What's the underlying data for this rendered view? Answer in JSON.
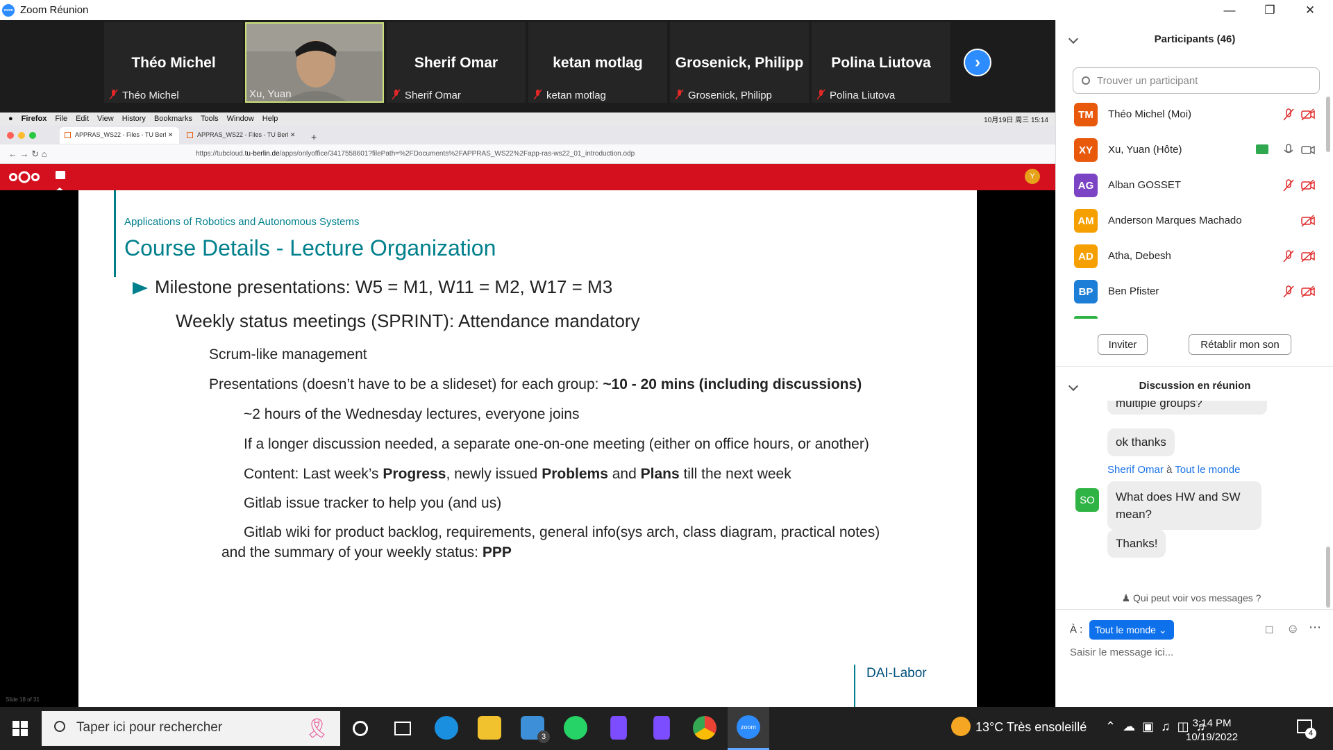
{
  "window": {
    "title": "Zoom Réunion",
    "controls": [
      "minimize-icon",
      "restore-icon",
      "close-icon"
    ]
  },
  "strip": {
    "tiles": [
      {
        "big": "Théo Michel",
        "small": "Théo Michel",
        "muted": true
      },
      {
        "big": "",
        "small": "Xu, Yuan",
        "muted": false,
        "video": true
      },
      {
        "big": "Sherif Omar",
        "small": "Sherif Omar",
        "muted": true
      },
      {
        "big": "ketan motlag",
        "small": "ketan motlag",
        "muted": true
      },
      {
        "big": "Grosenick, Philipp",
        "small": "Grosenick, Philipp",
        "muted": true
      },
      {
        "big": "Polina Liutova",
        "small": "Polina Liutova",
        "muted": true
      }
    ]
  },
  "share": {
    "mac_menu": [
      "Firefox",
      "File",
      "Edit",
      "View",
      "History",
      "Bookmarks",
      "Tools",
      "Window",
      "Help"
    ],
    "mac_clock": "10月19日 周三 15:14",
    "tabs": [
      "APPRAS_WS22 - Files - TU Berl",
      "APPRAS_WS22 - Files - TU Berl"
    ],
    "url_prefix": "https://tubcloud.",
    "url_domain": "tu-berlin.de",
    "url_rest": "/apps/onlyoffice/3417558601?filePath=%2FDocuments%2FAPPRAS_WS22%2Fapp-ras-ws22_01_introduction.odp",
    "slide": {
      "subtitle": "Applications of Robotics and Autonomous Systems",
      "title": "Course Details - Lecture Organization",
      "bullet1": "Milestone presentations: W5 = M1, W11 = M2, W17 = M3",
      "bullet2": "Weekly status meetings (SPRINT): Attendance mandatory",
      "bullet3": "Scrum-like management",
      "bullet4_pre": "Presentations (doesn’t have to be a slideset) for each group: ",
      "bullet4_bold": "~10 - 20 mins (including discussions)",
      "bullet5": "~2 hours of the Wednesday lectures, everyone joins",
      "bullet6": "If a longer discussion needed, a separate one-on-one meeting (either on office hours, or another)",
      "bullet7_a": "Content: Last week’s ",
      "bullet7_b": "Progress",
      "bullet7_c": ", newly issued ",
      "bullet7_d": "Problems",
      "bullet7_e": " and ",
      "bullet7_f": "Plans",
      "bullet7_g": " till the next week",
      "bullet8": "Gitlab issue tracker to help you (and us)",
      "bullet9_line1": "Gitlab wiki for product backlog, requirements, general info(sys arch, class diagram, practical notes)",
      "bullet9_line2": "and the summary of your weekly status: ",
      "bullet9_bold": "PPP",
      "logo": "DAI-Labor",
      "slide_counter": "Slide 18 of 31"
    }
  },
  "participants": {
    "header": "Participants (46)",
    "search_placeholder": "Trouver un participant",
    "list": [
      {
        "initials": "TM",
        "name": "Théo Michel (Moi)",
        "color": "#e8590c"
      },
      {
        "initials": "XY",
        "name": "Xu, Yuan (Hôte)",
        "color": "#e8590c"
      },
      {
        "initials": "AG",
        "name": "Alban GOSSET",
        "color": "#7b44c4"
      },
      {
        "initials": "AM",
        "name": "Anderson Marques Machado",
        "color": "#f59f00"
      },
      {
        "initials": "AD",
        "name": "Atha, Debesh",
        "color": "#f59f00"
      },
      {
        "initials": "BP",
        "name": "Ben Pfister",
        "color": "#1c7ed6"
      }
    ],
    "invite_label": "Inviter",
    "restore_sound_label": "Rétablir mon son"
  },
  "chat": {
    "header": "Discussion en réunion",
    "partial_msg": "multiple groups?",
    "msg1": "ok thanks",
    "sender_name": "Sherif Omar",
    "sender_sep": " à ",
    "sender_target": "Tout le monde",
    "sender_initials": "SO",
    "msg2": "What does HW and SW mean?",
    "msg3": "Thanks!",
    "who_can_see": "Qui peut voir vos messages ?",
    "to_label": "À :",
    "to_value": "Tout le monde",
    "input_placeholder": "Saisir le message ici..."
  },
  "taskbar": {
    "search_placeholder": "Taper ici pour rechercher",
    "mail_badge": "3",
    "weather": "13°C  Très ensoleillé",
    "time": "3:14 PM",
    "date": "10/19/2022",
    "notif_count": "4"
  }
}
